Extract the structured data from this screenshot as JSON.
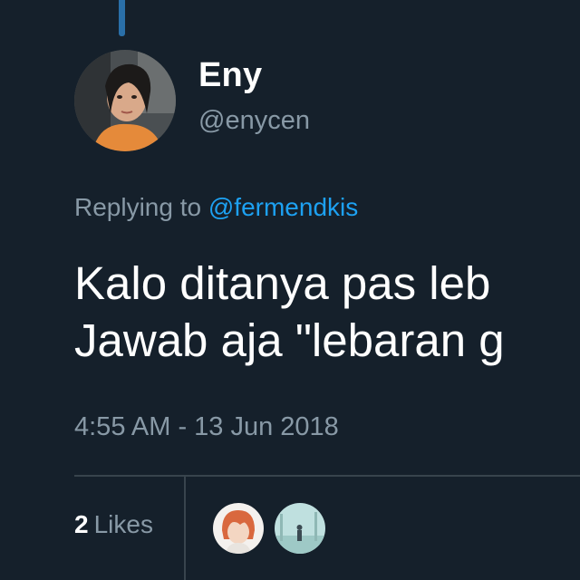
{
  "tweet": {
    "author": {
      "display_name": "Eny",
      "handle": "@enycen",
      "avatar_icon": "profile-photo"
    },
    "reply_prefix": "Replying to ",
    "reply_to": "@fermendkis",
    "text_lines": [
      "Kalo ditanya pas leb",
      "Jawab aja \"lebaran g"
    ],
    "timestamp": "4:55 AM - 13 Jun 2018",
    "likes": {
      "count": "2",
      "label": "Likes"
    },
    "likers": [
      {
        "avatar_icon": "anime-avatar"
      },
      {
        "avatar_icon": "landscape-avatar"
      }
    ]
  },
  "colors": {
    "background": "#15202b",
    "accent": "#1da1f2",
    "secondary_text": "#8899a6",
    "divider": "#38444d"
  }
}
